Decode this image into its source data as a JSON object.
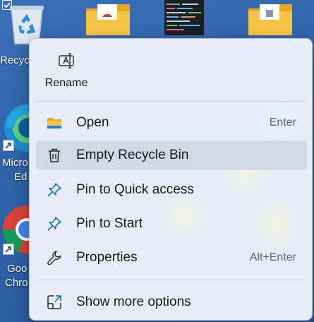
{
  "desktop": {
    "items": [
      {
        "label": "Recycle",
        "icon": "recycle-bin-icon"
      },
      {
        "label": "Micro",
        "label2": "Ed",
        "icon": "edge-icon"
      },
      {
        "label": "Goo",
        "label2": "Chro",
        "icon": "chrome-icon"
      }
    ]
  },
  "context_menu": {
    "rename": {
      "label": "Rename",
      "icon": "rename-icon"
    },
    "items": [
      {
        "label": "Open",
        "accelerator": "Enter",
        "icon": "folder-icon"
      },
      {
        "label": "Empty Recycle Bin",
        "accelerator": "",
        "icon": "trash-icon",
        "highlighted": true
      },
      {
        "label": "Pin to Quick access",
        "accelerator": "",
        "icon": "pin-icon"
      },
      {
        "label": "Pin to Start",
        "accelerator": "",
        "icon": "pin-icon"
      },
      {
        "label": "Properties",
        "accelerator": "Alt+Enter",
        "icon": "wrench-icon"
      }
    ],
    "more": {
      "label": "Show more options",
      "icon": "expand-icon"
    }
  },
  "colors": {
    "desktop_bg": "#2f62a8",
    "menu_bg": "#e7edf6",
    "accent": "#0067c0",
    "folder_yellow": "#f6c445"
  }
}
